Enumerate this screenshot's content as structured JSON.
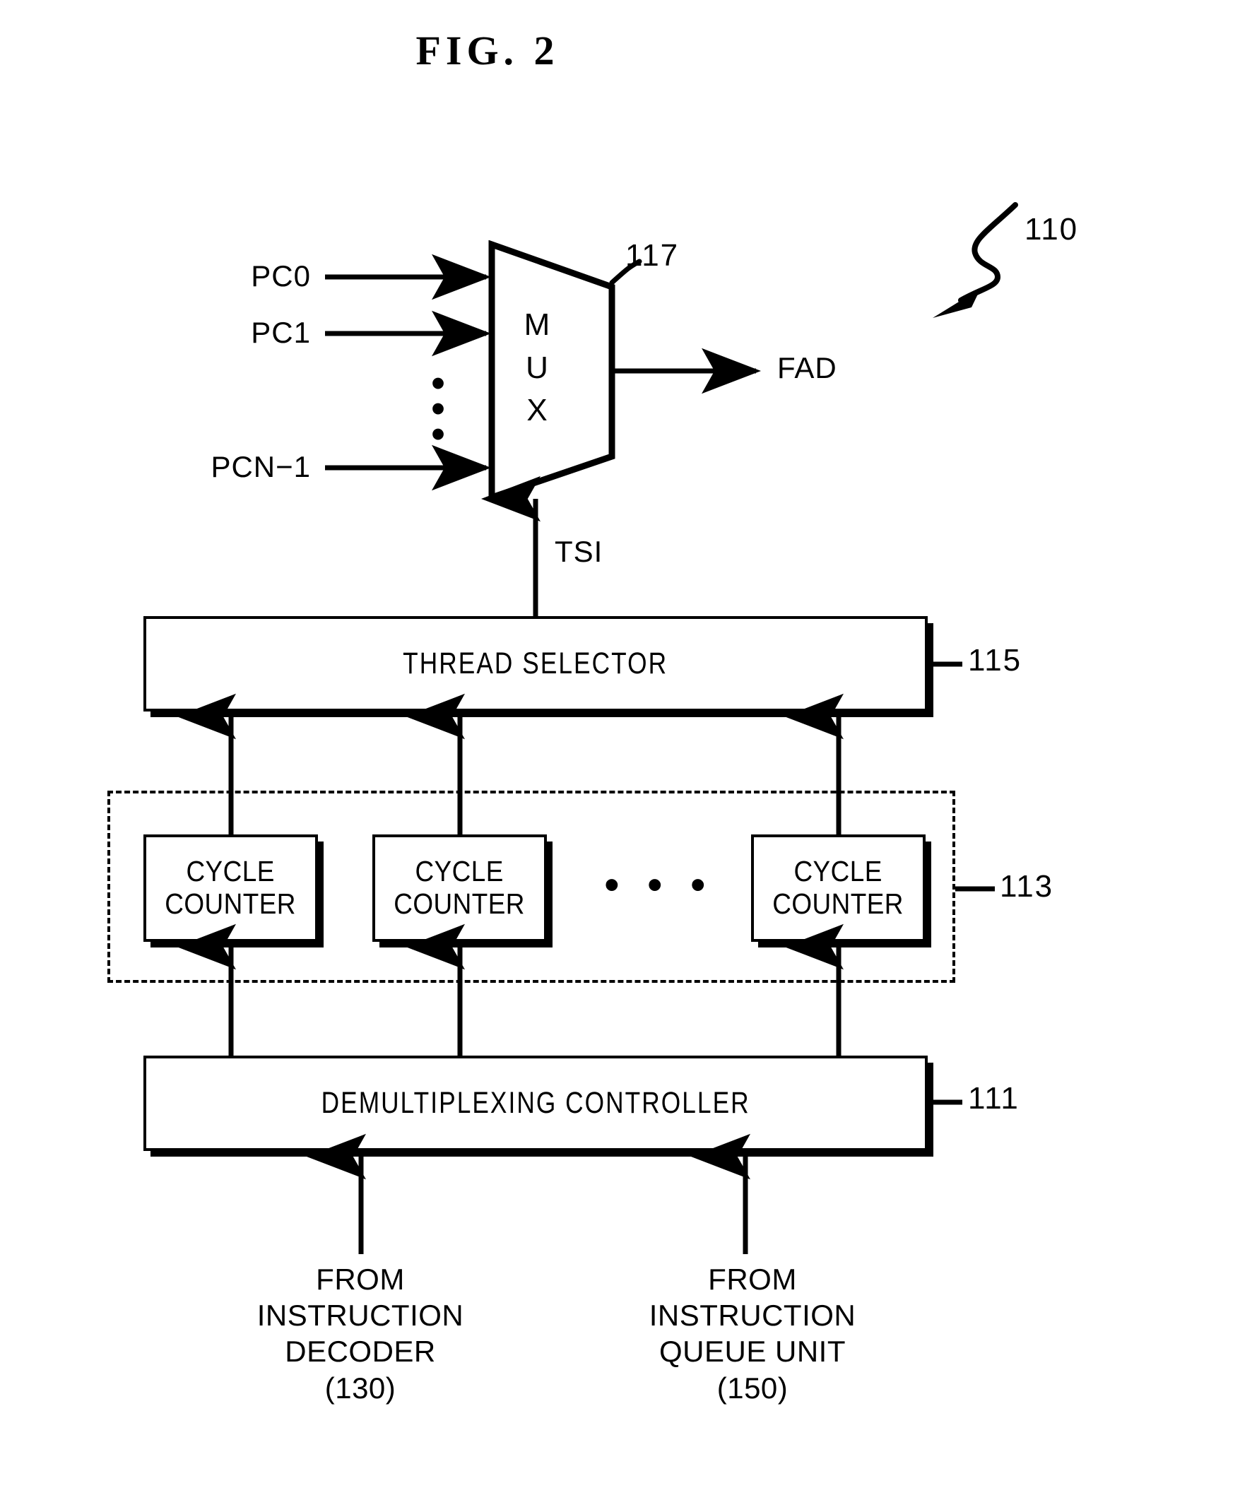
{
  "figure": {
    "title": "FIG. 2",
    "overall_ref": "110"
  },
  "mux": {
    "letters": [
      "M",
      "U",
      "X"
    ],
    "ref": "117",
    "inputs": [
      {
        "label": "PC0"
      },
      {
        "label": "PC1"
      },
      {
        "label": "PCN−1"
      }
    ],
    "input_ellipsis": "⋮",
    "output": {
      "label": "FAD"
    },
    "select": {
      "label": "TSI"
    }
  },
  "blocks": {
    "thread_selector": {
      "label": "THREAD SELECTOR",
      "ref": "115"
    },
    "counter_group": {
      "ref": "113",
      "ellipsis": "• • •"
    },
    "cycle_counters": [
      {
        "line1": "CYCLE",
        "line2": "COUNTER"
      },
      {
        "line1": "CYCLE",
        "line2": "COUNTER"
      },
      {
        "line1": "CYCLE",
        "line2": "COUNTER"
      }
    ],
    "demux_controller": {
      "label": "DEMULTIPLEXING CONTROLLER",
      "ref": "111"
    }
  },
  "sources": [
    {
      "line1": "FROM",
      "line2": "INSTRUCTION",
      "line3": "DECODER",
      "line4": "(130)"
    },
    {
      "line1": "FROM",
      "line2": "INSTRUCTION",
      "line3": "QUEUE UNIT",
      "line4": "(150)"
    }
  ],
  "colors": {
    "ink": "#000000",
    "paper": "#ffffff"
  }
}
